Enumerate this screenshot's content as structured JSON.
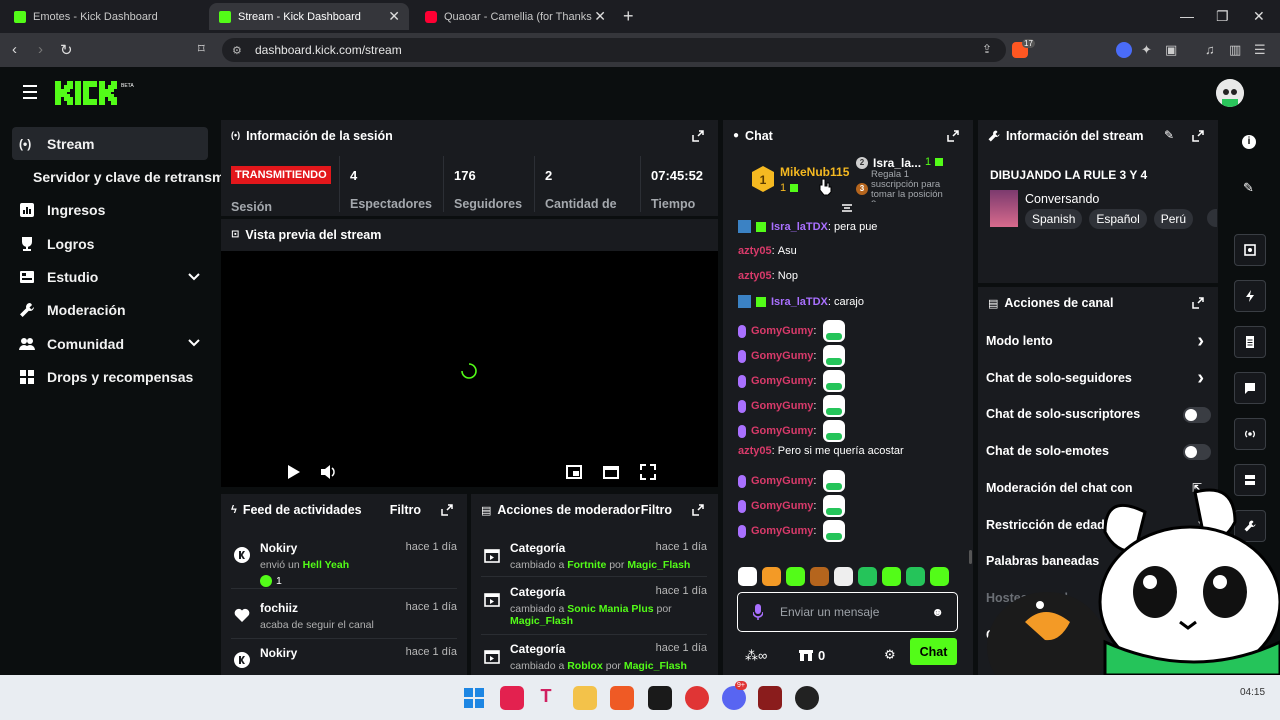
{
  "browser": {
    "tabs": [
      {
        "title": "Emotes - Kick Dashboard"
      },
      {
        "title": "Stream - Kick Dashboard"
      },
      {
        "title": "Quaoar - Camellia (for Thanks Tw"
      }
    ],
    "url": "dashboard.kick.com/stream",
    "brave_badge": "17"
  },
  "header": {
    "logo_text": "KICK",
    "beta": "BETA"
  },
  "sidebar": {
    "items": [
      {
        "label": "Stream"
      },
      {
        "label": "Servidor y clave de retransm"
      },
      {
        "label": "Ingresos"
      },
      {
        "label": "Logros"
      },
      {
        "label": "Estudio"
      },
      {
        "label": "Moderación"
      },
      {
        "label": "Comunidad"
      },
      {
        "label": "Drops y recompensas"
      }
    ]
  },
  "session": {
    "title": "Información de la sesión",
    "live_label": "TRANSMITIENDO",
    "session_label": "Sesión",
    "stats": [
      {
        "value": "4",
        "label": "Espectadores"
      },
      {
        "value": "176",
        "label": "Seguidores"
      },
      {
        "value": "2",
        "label": "Cantidad de"
      },
      {
        "value": "07:45:52",
        "label": "Tiempo"
      }
    ]
  },
  "preview": {
    "title": "Vista previa del stream"
  },
  "feed": {
    "title": "Feed de actividades",
    "filter": "Filtro",
    "items": [
      {
        "name": "Nokiry",
        "time": "hace 1 día",
        "pre": "envió un",
        "highlight": "Hell Yeah",
        "count": "1"
      },
      {
        "name": "fochiiz",
        "time": "hace 1 día",
        "text": "acaba de seguir el canal"
      },
      {
        "name": "Nokiry",
        "time": "hace 1 día"
      }
    ]
  },
  "modactions": {
    "title": "Acciones de moderador",
    "filter": "Filtro",
    "items": [
      {
        "title": "Categoría",
        "time": "hace 1 día",
        "pre": "cambiado a",
        "cat": "Fortnite",
        "by": "por",
        "user": "Magic_Flash"
      },
      {
        "title": "Categoría",
        "time": "hace 1 día",
        "pre": "cambiado a",
        "cat": "Sonic Mania Plus",
        "by": "por",
        "user": "Magic_Flash"
      },
      {
        "title": "Categoría",
        "time": "hace 1 día",
        "pre": "cambiado a",
        "cat": "Roblox",
        "by": "por",
        "user": "Magic_Flash"
      }
    ]
  },
  "chat": {
    "title": "Chat",
    "pinned": {
      "first": {
        "rank": "1",
        "name": "MikeNub115",
        "count": "1"
      },
      "second": {
        "rank": "2",
        "name": "Isra_la...",
        "count": "1"
      },
      "third": {
        "rank": "3",
        "text": "Regala 1 suscripción para tomar la posición 3"
      }
    },
    "messages": [
      {
        "user": "Isra_laTDX",
        "text": "pera pue",
        "color": "#a970ff"
      },
      {
        "user": "azty05",
        "text": "Asu",
        "color": "#d83a6a"
      },
      {
        "user": "azty05",
        "text": "Nop",
        "color": "#d83a6a"
      },
      {
        "user": "Isra_laTDX",
        "text": "carajo",
        "color": "#a970ff"
      },
      {
        "user": "GomyGumy",
        "text": "",
        "color": "#d83a6a"
      },
      {
        "user": "GomyGumy",
        "text": "",
        "color": "#d83a6a"
      },
      {
        "user": "GomyGumy",
        "text": "",
        "color": "#d83a6a"
      },
      {
        "user": "GomyGumy",
        "text": "",
        "color": "#d83a6a"
      },
      {
        "user": "GomyGumy",
        "text": "",
        "color": "#d83a6a"
      },
      {
        "user": "azty05",
        "text": "Pero si me quería acostar",
        "color": "#d83a6a"
      },
      {
        "user": "GomyGumy",
        "text": "",
        "color": "#d83a6a"
      },
      {
        "user": "GomyGumy",
        "text": "",
        "color": "#d83a6a"
      },
      {
        "user": "GomyGumy",
        "text": "",
        "color": "#d83a6a"
      }
    ],
    "input_placeholder": "Enviar un mensaje",
    "points": "0",
    "send_label": "Chat"
  },
  "streaminfo": {
    "title": "Información del stream",
    "stream_title": "DIBUJANDO LA RULE 3 Y 4",
    "category": "Conversando",
    "tags": [
      "Spanish",
      "Español",
      "Perú"
    ]
  },
  "channel": {
    "title": "Acciones de canal",
    "items": [
      {
        "label": "Modo lento"
      },
      {
        "label": "Chat de solo-seguidores"
      },
      {
        "label": "Chat de solo-suscriptores"
      },
      {
        "label": "Chat de solo-emotes"
      },
      {
        "label": "Moderación del chat con"
      },
      {
        "label": "Restricción de edad"
      },
      {
        "label": "Palabras baneadas"
      },
      {
        "label": "Hostear canal"
      },
      {
        "label": "Con"
      }
    ]
  },
  "taskbar": {
    "clock": "04:15",
    "discord_badge": "9+"
  }
}
